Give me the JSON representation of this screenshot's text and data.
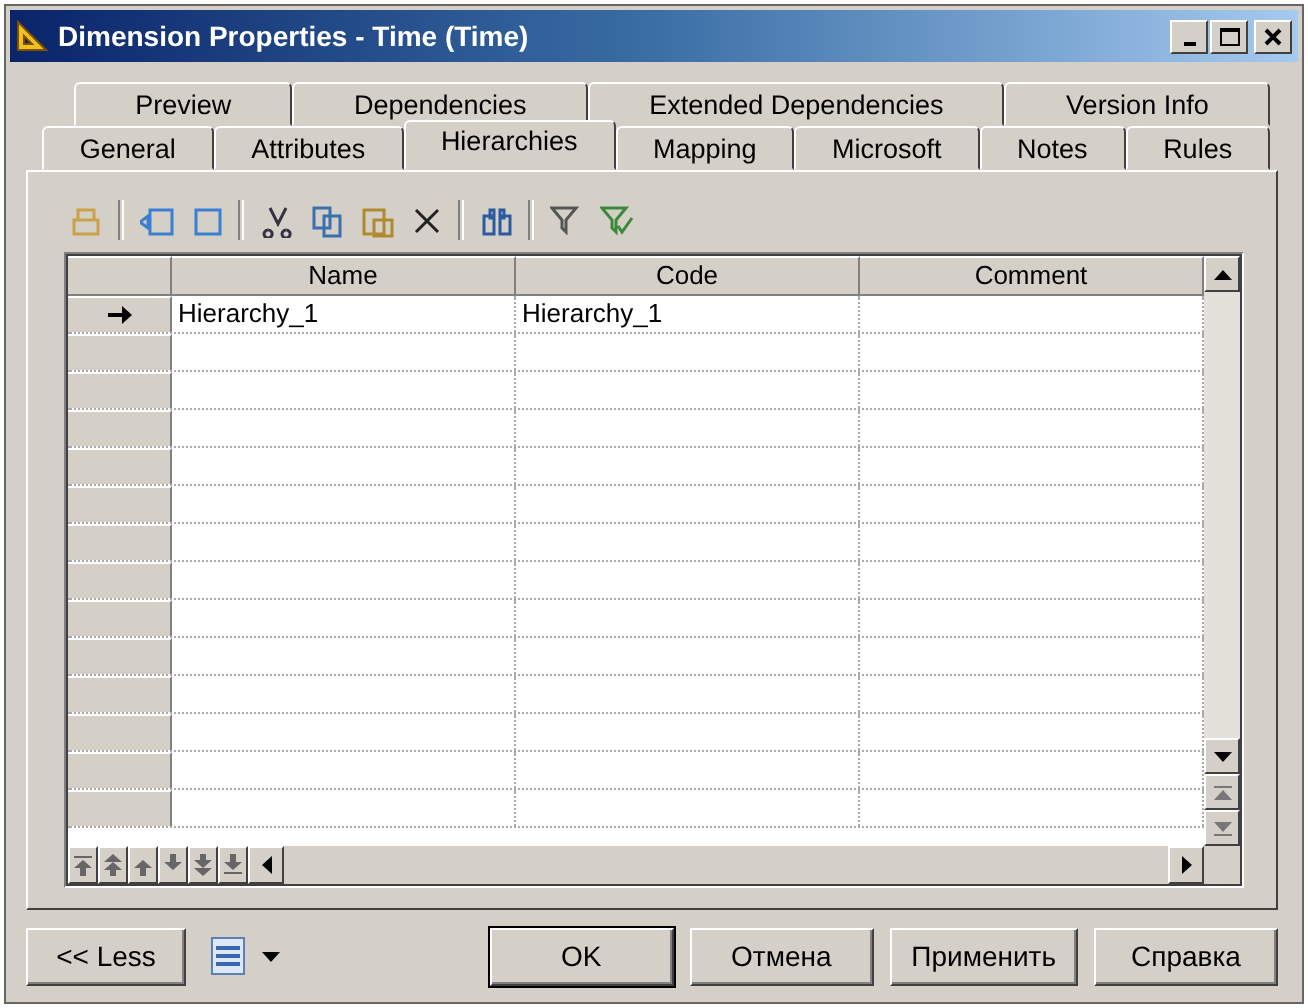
{
  "window": {
    "title": "Dimension Properties - Time (Time)"
  },
  "tab_rows": [
    {
      "tabs": [
        {
          "label": "Preview",
          "selected": false
        },
        {
          "label": "Dependencies",
          "selected": false
        },
        {
          "label": "Extended Dependencies",
          "selected": false
        },
        {
          "label": "Version Info",
          "selected": false
        }
      ]
    },
    {
      "tabs": [
        {
          "label": "General",
          "selected": false
        },
        {
          "label": "Attributes",
          "selected": false
        },
        {
          "label": "Hierarchies",
          "selected": true
        },
        {
          "label": "Mapping",
          "selected": false
        },
        {
          "label": "Microsoft",
          "selected": false
        },
        {
          "label": "Notes",
          "selected": false
        },
        {
          "label": "Rules",
          "selected": false
        }
      ]
    }
  ],
  "table": {
    "columns": [
      "Name",
      "Code",
      "Comment"
    ],
    "rows": [
      {
        "cells": [
          "Hierarchy_1",
          "Hierarchy_1",
          ""
        ],
        "current": true
      }
    ]
  },
  "buttons": {
    "less": "<< Less",
    "ok": "OK",
    "cancel": "Отмена",
    "apply": "Применить",
    "help": "Справка"
  }
}
